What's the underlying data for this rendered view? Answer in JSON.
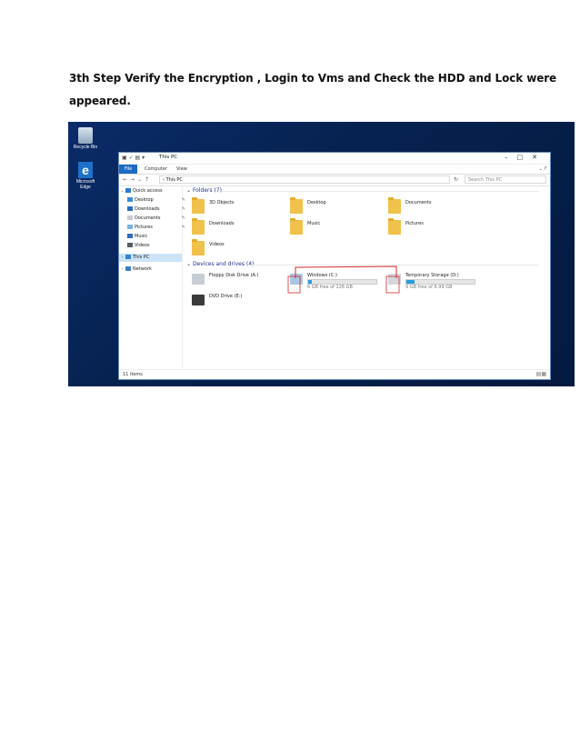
{
  "document": {
    "line1": "3th  Step Verify the Encryption , Login to Vms and Check the HDD and Lock were",
    "line2": "appeared."
  },
  "desktop": {
    "icons": [
      {
        "label": "Recycle Bin",
        "icon": "recycle-bin-icon"
      },
      {
        "label": "Microsoft Edge",
        "icon": "edge-icon"
      }
    ]
  },
  "explorer": {
    "title": "This PC",
    "ribbon": {
      "file": "File",
      "computer": "Computer",
      "view": "View"
    },
    "address": "This PC",
    "search_placeholder": "Search This PC",
    "nav": [
      {
        "label": "Quick access",
        "pinned": false
      },
      {
        "label": "Desktop",
        "pinned": true
      },
      {
        "label": "Downloads",
        "pinned": true
      },
      {
        "label": "Documents",
        "pinned": true
      },
      {
        "label": "Pictures",
        "pinned": true
      },
      {
        "label": "Music",
        "pinned": false
      },
      {
        "label": "Videos",
        "pinned": false
      },
      {
        "label": "This PC",
        "pinned": false,
        "selected": true
      },
      {
        "label": "Network",
        "pinned": false
      }
    ],
    "folders_header": "Folders (7)",
    "folders": [
      "3D Objects",
      "Desktop",
      "Documents",
      "Downloads",
      "Music",
      "Pictures",
      "Videos"
    ],
    "devices_header": "Devices and drives (4)",
    "drives": [
      {
        "name": "Floppy Disk Drive (A:)",
        "free": "",
        "used_fraction": null
      },
      {
        "name": "Windows (C:)",
        "free": "6 GB free of 126 GB",
        "used_fraction": 0.05
      },
      {
        "name": "Temporary Storage (D:)",
        "free": "9 GB free of 6.99 GB",
        "used_fraction": 0.12
      },
      {
        "name": "DVD Drive (E:)",
        "free": "",
        "used_fraction": null
      }
    ],
    "status": "11 items"
  },
  "colors": {
    "accent": "#1c6cc4",
    "annotation": "#d12c2c",
    "desktop_bg": "#06224f"
  }
}
